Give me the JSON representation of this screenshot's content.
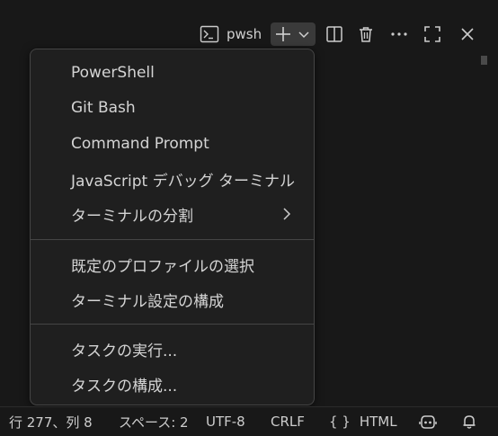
{
  "toolbar": {
    "terminal_name": "pwsh",
    "icons": [
      "terminal-icon",
      "plus-icon",
      "chevron-down-icon",
      "split-icon",
      "trash-icon",
      "more-icon",
      "maximize-icon",
      "close-icon"
    ]
  },
  "menu": {
    "profiles": [
      {
        "label": "PowerShell"
      },
      {
        "label": "Git Bash"
      },
      {
        "label": "Command Prompt"
      },
      {
        "label": "JavaScript デバッグ ターミナル"
      },
      {
        "label": "ターミナルの分割"
      }
    ],
    "settings": [
      {
        "label": "既定のプロファイルの選択"
      },
      {
        "label": "ターミナル設定の構成"
      }
    ],
    "tasks": [
      {
        "label": "タスクの実行..."
      },
      {
        "label": "タスクの構成..."
      }
    ]
  },
  "statusbar": {
    "position": "行 277、列 8",
    "indent": "スペース: 2",
    "encoding": "UTF-8",
    "eol": "CRLF",
    "language_icon": "{ }",
    "language": "HTML"
  },
  "colors": {
    "background": "#181818",
    "menu_background": "#1f1f1f",
    "menu_border": "#454545",
    "text": "#cccccc"
  }
}
